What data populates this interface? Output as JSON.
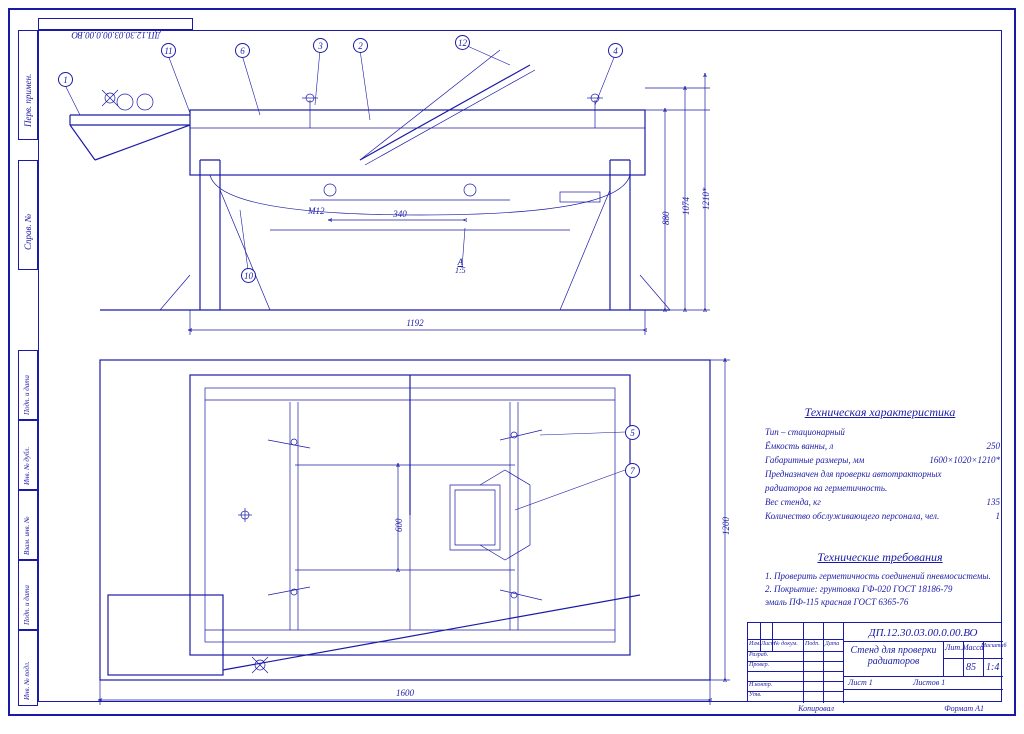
{
  "drawing_number_top": "ДП.12.30.03.00.0.00.ВО",
  "title_block": {
    "number": "ДП.12.30.03.00.0.00.ВО",
    "title_line1": "Стенд для проверки",
    "title_line2": "радиаторов",
    "masa_label": "Масса",
    "masshtab_label": "Масштаб",
    "lit_label": "Лит.",
    "mass": "85",
    "scale": "1:4",
    "sheet_label": "Лист 1",
    "sheets_label": "Листов 1",
    "format_label": "Формат  А1",
    "kopiroval_label": "Копировал",
    "cols": {
      "izm": "Изм.",
      "list": "Лист",
      "ndoc": "№ докум.",
      "podp": "Подп.",
      "data": "Дата"
    },
    "rows": [
      "Разраб.",
      "Провер.",
      "",
      "Н.контр.",
      "Утв."
    ]
  },
  "side_blocks": [
    "Инв. № подл.",
    "Подп. и дата",
    "Взам. инв. №",
    "Инв. № дубл.",
    "Подп. и дата"
  ],
  "perv_primen": "Перв. примен.",
  "sprav_no": "Справ. №",
  "dimensions": {
    "height_total": "1210*",
    "height_880": "880",
    "height_1074": "1074",
    "width_1192": "1192",
    "width_340": "340",
    "m12": "М12",
    "a15": "А\n1:5",
    "plan_1600": "1600",
    "plan_1200": "1200",
    "plan_600": "600",
    "gabarit": "1600×1020×1210*"
  },
  "balloons": [
    "1",
    "2",
    "3",
    "4",
    "5",
    "6",
    "7",
    "10",
    "11",
    "12"
  ],
  "tech_char": {
    "title": "Техническая характеристика",
    "lines": [
      [
        "Тип  –  стационарный",
        ""
      ],
      [
        "Ёмкость ванны, л",
        "250"
      ],
      [
        "Габаритные размеры, мм",
        "1600×1020×1210*"
      ],
      [
        "Предназначен для проверки автотракторных",
        ""
      ],
      [
        "  радиаторов на герметичность.",
        ""
      ],
      [
        "Вес стенда, кг",
        "135"
      ],
      [
        "Количество обслуживающего персонала, чел.",
        "1"
      ]
    ]
  },
  "tech_req": {
    "title": "Технические требования",
    "lines": [
      "1. Проверить герметичность соединений пневмосистемы.",
      "2. Покрытие: грунтовка ГФ-020 ГОСТ 18186-79",
      "     эмаль ПФ-115 красная ГОСТ 6365-76"
    ]
  }
}
